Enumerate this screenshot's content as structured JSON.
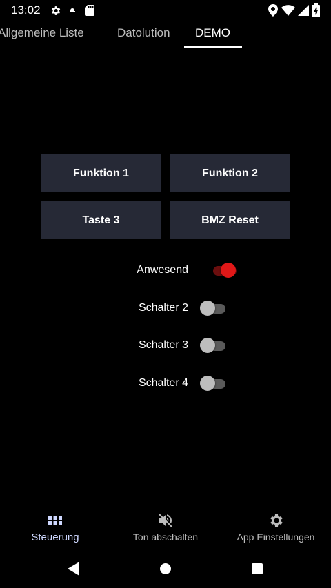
{
  "status_bar": {
    "time": "13:02",
    "left_icons": [
      "gear-icon",
      "notification-icon",
      "sd-card-icon"
    ],
    "right_icons": [
      "location-icon",
      "wifi-icon",
      "signal-icon",
      "battery-icon"
    ]
  },
  "tabs": [
    {
      "label": "Allgemeine Liste",
      "active": false
    },
    {
      "label": "Datolution",
      "active": false
    },
    {
      "label": "DEMO",
      "active": true
    }
  ],
  "buttons": [
    {
      "label": "Funktion 1"
    },
    {
      "label": "Funktion 2"
    },
    {
      "label": "Taste 3"
    },
    {
      "label": "BMZ Reset"
    }
  ],
  "switches": [
    {
      "label": "Anwesend",
      "on": true
    },
    {
      "label": "Schalter 2",
      "on": false
    },
    {
      "label": "Schalter 3",
      "on": false
    },
    {
      "label": "Schalter 4",
      "on": false
    }
  ],
  "bottom_nav": [
    {
      "label": "Steuerung",
      "icon": "grid-icon",
      "active": true
    },
    {
      "label": "Ton abschalten",
      "icon": "mute-icon",
      "active": false
    },
    {
      "label": "App Einstellungen",
      "icon": "settings-icon",
      "active": false
    }
  ],
  "colors": {
    "background": "#000000",
    "button_bg": "#262936",
    "switch_on": "#e01818",
    "switch_off_thumb": "#bdbdbd"
  }
}
